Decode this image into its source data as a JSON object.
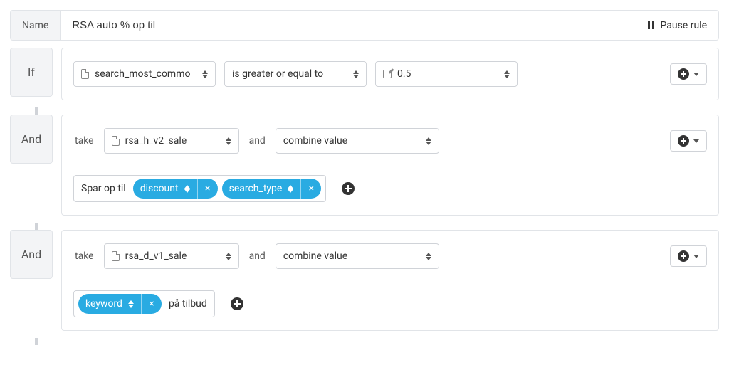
{
  "header": {
    "name_label": "Name",
    "name_value": "RSA auto % op til",
    "pause_label": "Pause rule"
  },
  "blocks": [
    {
      "tag": "If",
      "condition": {
        "field": "search_most_commo",
        "operator": "is greater or equal to",
        "value": "0.5"
      }
    },
    {
      "tag": "And",
      "take_label": "take",
      "take_field": "rsa_h_v2_sale",
      "and_label": "and",
      "action": "combine value",
      "tokens": {
        "prefix": "Spar op til",
        "chips": [
          "discount",
          "search_type"
        ],
        "suffix": ""
      }
    },
    {
      "tag": "And",
      "take_label": "take",
      "take_field": "rsa_d_v1_sale",
      "and_label": "and",
      "action": "combine value",
      "tokens": {
        "prefix": "",
        "chips": [
          "keyword"
        ],
        "suffix": "på tilbud"
      }
    }
  ]
}
